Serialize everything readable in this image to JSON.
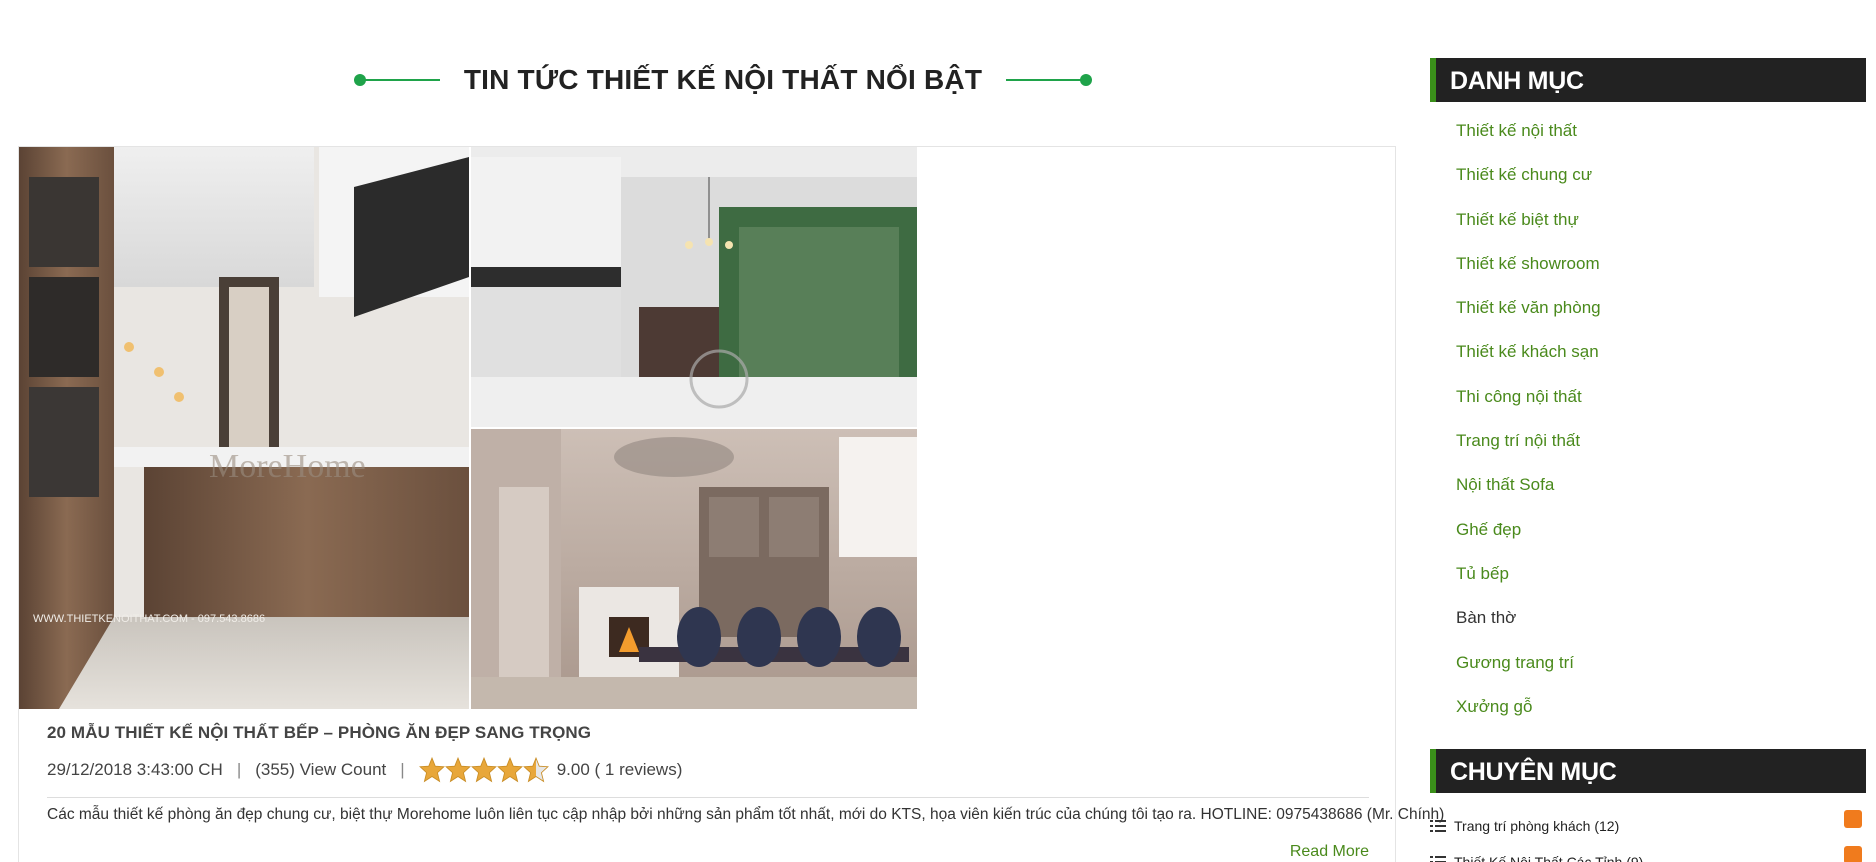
{
  "main": {
    "section_title": "TIN TỨC THIẾT KẾ NỘI THẤT NỔI BẬT",
    "post": {
      "image_watermark": "MoreHome",
      "image_website_text": "WWW.THIETKENOITHAT.COM - 097.543.8686",
      "title": "20 MẪU THIẾT KẾ NỘI THẤT BẾP – PHÒNG ĂN ĐẸP SANG TRỌNG",
      "date": "29/12/2018 3:43:00 CH",
      "separator": "|",
      "view_count": "(355) View Count",
      "rating_value": 4.5,
      "rating_max": 5,
      "rating_text": "9.00 ( 1 reviews)",
      "excerpt": "Các mẫu thiết kế phòng ăn đẹp chung cư, biệt thự Morehome luôn liên tục cập nhập bởi những sản phẩm tốt nhất, mới do KTS, họa viên kiến trúc của chúng tôi tạo ra. HOTLINE: 0975438686 (Mr. Chính)",
      "read_more": "Read More"
    }
  },
  "sidebar": {
    "danh_muc_title": "DANH MỤC",
    "categories": [
      {
        "label": "Thiết kế nội thất"
      },
      {
        "label": "Thiết kế chung cư"
      },
      {
        "label": "Thiết kế biệt thự"
      },
      {
        "label": "Thiết kế showroom"
      },
      {
        "label": "Thiết kế văn phòng"
      },
      {
        "label": "Thiết kế khách sạn"
      },
      {
        "label": "Thi công nội thất"
      },
      {
        "label": "Trang trí nội thất"
      },
      {
        "label": "Nội thất Sofa"
      },
      {
        "label": "Ghế đẹp"
      },
      {
        "label": "Tủ bếp"
      },
      {
        "label": "Bàn thờ"
      },
      {
        "label": "Gương trang trí"
      },
      {
        "label": "Xưởng gỗ"
      }
    ],
    "chuyen_muc_title": "CHUYÊN MỤC",
    "topics": [
      {
        "label": "Trang trí phòng khách (12)"
      },
      {
        "label": "Thiết Kế Nội Thất Các Tỉnh (9)"
      }
    ]
  },
  "colors": {
    "accent_green": "#1fa34a",
    "link_green": "#4a8a1c",
    "widget_header_bg": "#222222",
    "widget_header_border": "#3a8f1a",
    "rss_orange": "#f07b1d",
    "star_gold": "#e8a73a"
  },
  "icons": {
    "heading_decoration": "dot-line-icon",
    "rating": "star-icon",
    "topic_bullet": "list-icon",
    "feed": "rss-icon"
  }
}
